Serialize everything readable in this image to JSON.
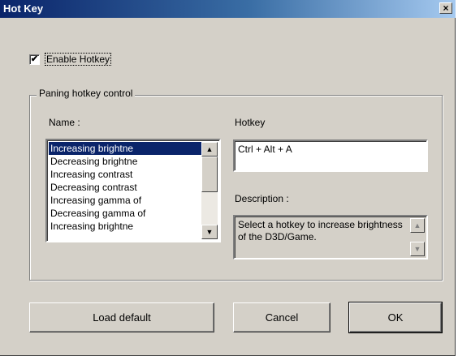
{
  "window": {
    "title": "Hot Key",
    "close_glyph": "×"
  },
  "enable_hotkey": {
    "label": "Enable Hotkey",
    "checked": true,
    "check_glyph": "✔"
  },
  "group": {
    "legend": "Paning hotkey control",
    "name_label": "Name :",
    "hotkey_label": "Hotkey",
    "description_label": "Description :"
  },
  "name_list": {
    "items": [
      "Increasing brightne",
      "Decreasing brightne",
      "Increasing contrast",
      "Decreasing contrast",
      "Increasing gamma of",
      "Decreasing gamma of",
      "Increasing brightne"
    ],
    "selected_index": 0,
    "scroll_up_glyph": "▲",
    "scroll_down_glyph": "▼"
  },
  "hotkey": {
    "value": "Ctrl + Alt + A"
  },
  "description": {
    "text": "Select a hotkey to increase brightness of the D3D/Game.",
    "scroll_up_glyph": "▲",
    "scroll_down_glyph": "▼"
  },
  "buttons": {
    "load_default": "Load default",
    "cancel": "Cancel",
    "ok": "OK"
  }
}
